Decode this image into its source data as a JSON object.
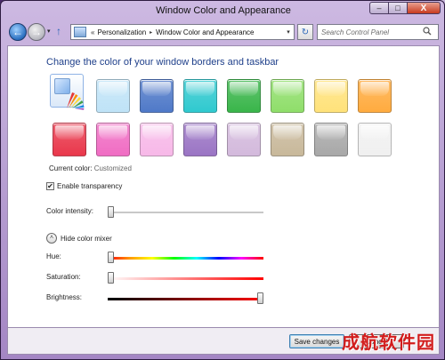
{
  "window": {
    "title": "Window Color and Appearance",
    "controls": {
      "minimize": "–",
      "maximize": "□",
      "close": "X"
    }
  },
  "nav": {
    "back": "←",
    "forward": "→",
    "recent": "▾",
    "up": "↑",
    "address_prefix": "«",
    "breadcrumbs": [
      "Personalization",
      "Window Color and Appearance"
    ],
    "crumb_separator": "▸",
    "address_dropdown": "▾",
    "refresh": "↻",
    "search_placeholder": "Search Control Panel",
    "search_icon": "magnifier-icon"
  },
  "main": {
    "heading": "Change the color of your window borders and taskbar",
    "swatches_row1": [
      {
        "name": "sky",
        "color": "#bfe3f7"
      },
      {
        "name": "twilight",
        "color": "#4f79c8"
      },
      {
        "name": "sea",
        "color": "#2fc9cf"
      },
      {
        "name": "leaf",
        "color": "#39b54a"
      },
      {
        "name": "lime",
        "color": "#8fde6a"
      },
      {
        "name": "sun",
        "color": "#ffe27a"
      },
      {
        "name": "pumpkin",
        "color": "#ffab3f"
      }
    ],
    "swatches_row2": [
      {
        "name": "ruby",
        "color": "#e9374b"
      },
      {
        "name": "fuchsia",
        "color": "#f06cc3"
      },
      {
        "name": "blush",
        "color": "#f7b8e8"
      },
      {
        "name": "violet",
        "color": "#9a74c4"
      },
      {
        "name": "lavender",
        "color": "#d3b9dc"
      },
      {
        "name": "taupe",
        "color": "#c8b89a"
      },
      {
        "name": "chocolate",
        "color": "#a8a8a8"
      },
      {
        "name": "slate",
        "color": "#f0f0f0"
      }
    ],
    "current_color_label": "Current color:",
    "current_color_value": "Customized",
    "enable_transparency_label": "Enable transparency",
    "enable_transparency_checked": true,
    "checkmark": "✔",
    "color_intensity_label": "Color intensity:",
    "color_intensity_value": 0.0,
    "mixer_toggle_icon": "˄",
    "mixer_toggle_label": "Hide color mixer",
    "hue_label": "Hue:",
    "hue_value": 0.0,
    "saturation_label": "Saturation:",
    "saturation_value": 0.0,
    "brightness_label": "Brightness:",
    "brightness_value": 1.0
  },
  "footer": {
    "save_label": "Save changes",
    "cancel_label": "Cancel"
  },
  "watermark": "成航软件园",
  "colors": {
    "heading": "#1e3f8a",
    "title_bar": "#b79fd2"
  }
}
